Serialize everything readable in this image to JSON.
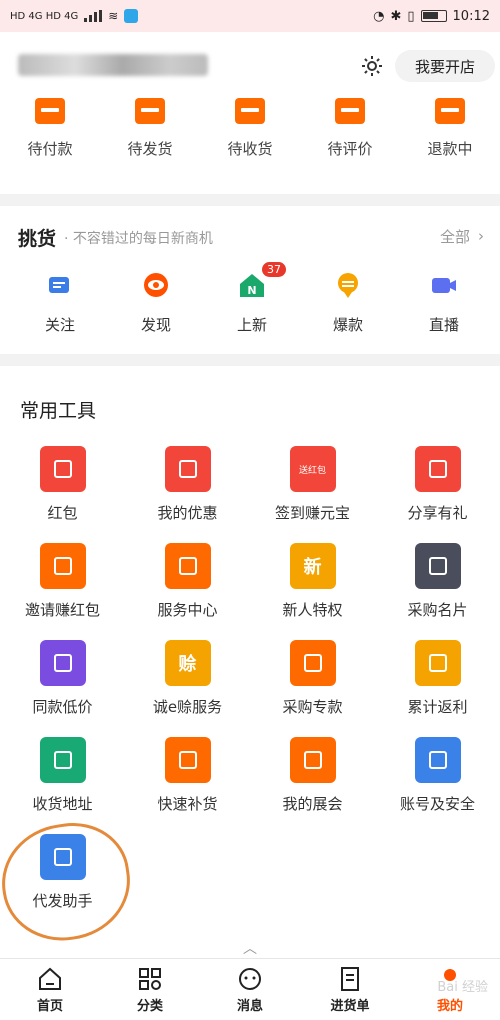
{
  "status_bar": {
    "left": "HD 4G HD 4G",
    "time": "10:12"
  },
  "header": {
    "open_shop": "我要开店"
  },
  "orders": [
    {
      "label": "待付款",
      "icon": "wallet-icon"
    },
    {
      "label": "待发货",
      "icon": "box-icon"
    },
    {
      "label": "待收货",
      "icon": "truck-icon"
    },
    {
      "label": "待评价",
      "icon": "comment-icon"
    },
    {
      "label": "退款中",
      "icon": "refund-icon"
    }
  ],
  "tiaohuo": {
    "title": "挑货",
    "subtitle": "· 不容错过的每日新商机",
    "all_label": "全部",
    "items": [
      {
        "label": "关注",
        "icon": "follow-icon",
        "color": "#3b7de8"
      },
      {
        "label": "发现",
        "icon": "eye-icon",
        "color": "#ff5000"
      },
      {
        "label": "上新",
        "icon": "new-house-icon",
        "color": "#1aa86b",
        "badge": "37"
      },
      {
        "label": "爆款",
        "icon": "hot-icon",
        "color": "#f7a400"
      },
      {
        "label": "直播",
        "icon": "live-icon",
        "color": "#5b6ff0"
      }
    ]
  },
  "tools": {
    "title": "常用工具",
    "items": [
      {
        "label": "红包",
        "color": "#f2463a",
        "icon": "red-packet-icon"
      },
      {
        "label": "我的优惠",
        "color": "#f2463a",
        "icon": "coupon-icon"
      },
      {
        "label": "签到赚元宝",
        "color": "#f2463a",
        "icon": "sign-in-icon",
        "text": "送红包"
      },
      {
        "label": "分享有礼",
        "color": "#f2463a",
        "icon": "share-icon"
      },
      {
        "label": "邀请赚红包",
        "color": "#ff6a00",
        "icon": "invite-icon"
      },
      {
        "label": "服务中心",
        "color": "#ff6a00",
        "icon": "service-icon"
      },
      {
        "label": "新人特权",
        "color": "#f5a300",
        "icon": "newbie-icon",
        "text": "新"
      },
      {
        "label": "采购名片",
        "color": "#4a4d5c",
        "icon": "card-icon"
      },
      {
        "label": "同款低价",
        "color": "#7a4de0",
        "icon": "bell-icon"
      },
      {
        "label": "诚e赊服务",
        "color": "#f5a300",
        "icon": "credit-icon",
        "text": "赊"
      },
      {
        "label": "采购专款",
        "color": "#ff6a00",
        "icon": "fund-icon"
      },
      {
        "label": "累计返利",
        "color": "#f5a300",
        "icon": "rebate-icon"
      },
      {
        "label": "收货地址",
        "color": "#19a974",
        "icon": "location-icon"
      },
      {
        "label": "快速补货",
        "color": "#ff6a00",
        "icon": "restock-icon"
      },
      {
        "label": "我的展会",
        "color": "#ff6a00",
        "icon": "expo-icon"
      },
      {
        "label": "账号及安全",
        "color": "#3b82e8",
        "icon": "lock-icon"
      },
      {
        "label": "代发助手",
        "color": "#3b82e8",
        "icon": "dropship-icon"
      }
    ]
  },
  "tabbar": [
    {
      "label": "首页",
      "icon": "home-icon"
    },
    {
      "label": "分类",
      "icon": "category-icon"
    },
    {
      "label": "消息",
      "icon": "message-icon"
    },
    {
      "label": "进货单",
      "icon": "purchase-list-icon"
    },
    {
      "label": "我的",
      "icon": "mine-icon",
      "active": true
    }
  ],
  "watermark": "Bai 经验"
}
